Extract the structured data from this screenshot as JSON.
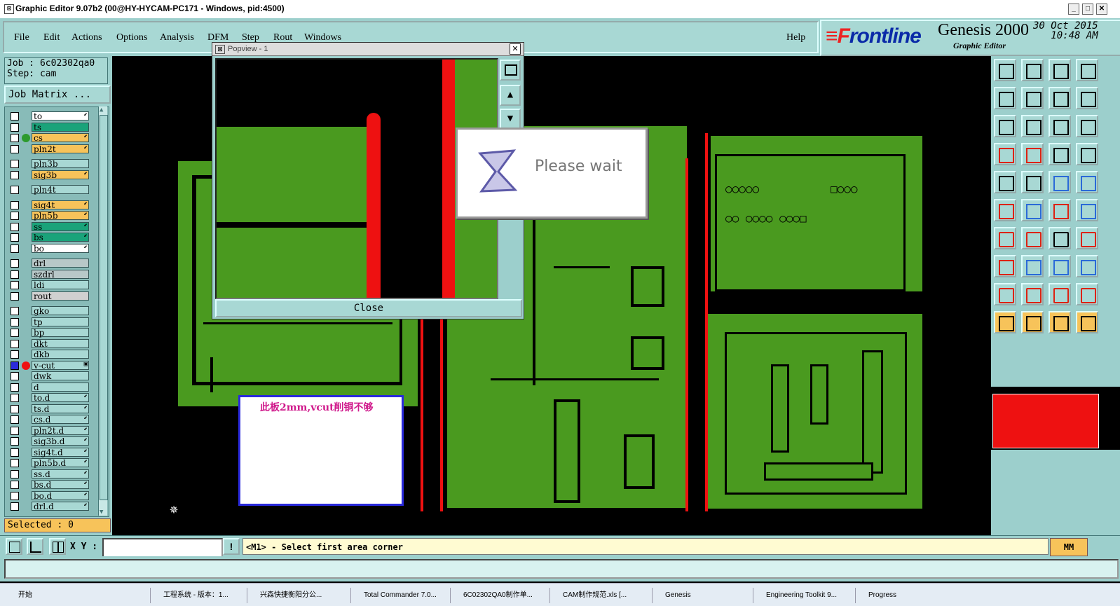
{
  "window": {
    "title": "Graphic Editor 9.07b2 (00@HY-HYCAM-PC171 - Windows, pid:4500)"
  },
  "menu": [
    "File",
    "Edit",
    "Actions",
    "Options",
    "Analysis",
    "DFM",
    "Step",
    "Rout",
    "Windows"
  ],
  "help": "Help",
  "brand": {
    "logo_pre": "≡F",
    "logo_post": "rontline",
    "product": "Genesis 2000",
    "subtitle": "Graphic Editor",
    "date": "30 Oct 2015",
    "time": "10:48 AM"
  },
  "job": {
    "job": "Job : 6c02302qa0",
    "step": "Step: cam",
    "matrix_button": "Job Matrix ..."
  },
  "layers": [
    {
      "name": "to",
      "color": "#ffffff",
      "mark": "⬋"
    },
    {
      "name": "ts",
      "color": "#1aa37a",
      "mark": ""
    },
    {
      "name": "cs",
      "color": "#f7c35a",
      "mark": "⬋",
      "dot": "#2d9a2d"
    },
    {
      "name": "pln2t",
      "color": "#f7c35a",
      "mark": "⬋"
    },
    {
      "name": "pln3b",
      "color": "#a8d8d4",
      "mark": ""
    },
    {
      "name": "sig3b",
      "color": "#f7c35a",
      "mark": "⬋"
    },
    {
      "name": "pln4t",
      "color": "#a8d8d4",
      "mark": ""
    },
    {
      "name": "sig4t",
      "color": "#f7c35a",
      "mark": "⬋"
    },
    {
      "name": "pln5b",
      "color": "#f7c35a",
      "mark": "⬋"
    },
    {
      "name": "ss",
      "color": "#1aa37a",
      "mark": "⬋"
    },
    {
      "name": "bs",
      "color": "#1aa37a",
      "mark": "⬋"
    },
    {
      "name": "bo",
      "color": "#ffffff",
      "mark": "⬋"
    },
    {
      "name": "drl",
      "color": "#b8c8c8",
      "mark": ""
    },
    {
      "name": "szdrl",
      "color": "#b8c8c8",
      "mark": ""
    },
    {
      "name": "ldi",
      "color": "#a8d8d4",
      "mark": ""
    },
    {
      "name": "rout",
      "color": "#d0d0d0",
      "mark": ""
    },
    {
      "name": "gko",
      "color": "#a8d8d4",
      "mark": ""
    },
    {
      "name": "tp",
      "color": "#a8d8d4",
      "mark": ""
    },
    {
      "name": "bp",
      "color": "#a8d8d4",
      "mark": ""
    },
    {
      "name": "dkt",
      "color": "#a8d8d4",
      "mark": ""
    },
    {
      "name": "dkb",
      "color": "#a8d8d4",
      "mark": ""
    },
    {
      "name": "v-cut",
      "color": "#a8d8d4",
      "mark": "▣",
      "dot": "#e11"
    },
    {
      "name": "dwk",
      "color": "#a8d8d4",
      "mark": ""
    },
    {
      "name": "d",
      "color": "#a8d8d4",
      "mark": ""
    },
    {
      "name": "to.d",
      "color": "#a8d8d4",
      "mark": "⬋"
    },
    {
      "name": "ts.d",
      "color": "#a8d8d4",
      "mark": "⬋"
    },
    {
      "name": "cs.d",
      "color": "#a8d8d4",
      "mark": "⬋"
    },
    {
      "name": "pln2t.d",
      "color": "#a8d8d4",
      "mark": "⬋"
    },
    {
      "name": "sig3b.d",
      "color": "#a8d8d4",
      "mark": "⬋"
    },
    {
      "name": "sig4t.d",
      "color": "#a8d8d4",
      "mark": "⬋"
    },
    {
      "name": "pln5b.d",
      "color": "#a8d8d4",
      "mark": "⬋"
    },
    {
      "name": "ss.d",
      "color": "#a8d8d4",
      "mark": "⬋"
    },
    {
      "name": "bs.d",
      "color": "#a8d8d4",
      "mark": "⬋"
    },
    {
      "name": "bo.d",
      "color": "#a8d8d4",
      "mark": "⬋"
    },
    {
      "name": "drl.d",
      "color": "#a8d8d4",
      "mark": "⬋"
    }
  ],
  "selected": "Selected : 0",
  "popview": {
    "title": "Popview - 1",
    "close": "Close"
  },
  "wait": {
    "text": "Please wait"
  },
  "note": {
    "text": "此板2mm,vcut削铜不够"
  },
  "status": {
    "xy_label": "X Y :",
    "message": "<M1> - Select first area corner",
    "units": "MM",
    "alert": "!"
  },
  "taskbar": {
    "start": "开始",
    "items": [
      "工程系统 - 版本：1...",
      "兴森快捷衡阳分公...",
      "Total Commander 7.0...",
      "6C02302QA0制作单...",
      "CAM制作规范.xls [...",
      "Genesis",
      "Engineering Toolkit 9...",
      "Progress"
    ]
  }
}
